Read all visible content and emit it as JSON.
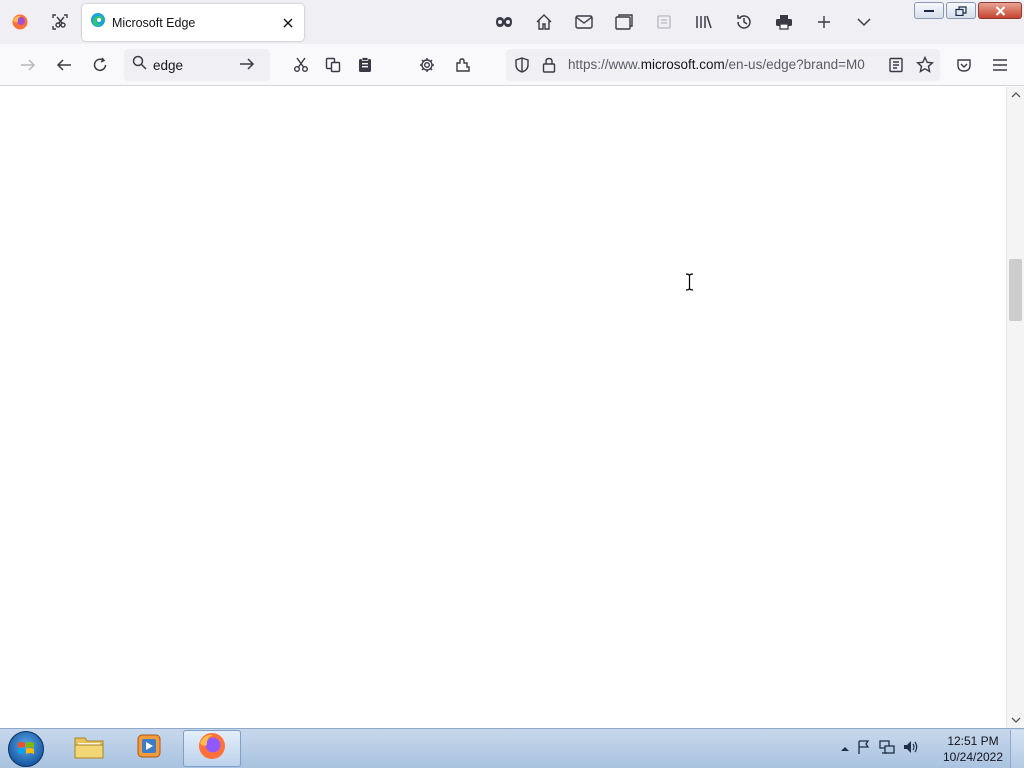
{
  "browser": {
    "tab": {
      "title": "Microsoft Edge"
    },
    "search": {
      "value": "edge"
    },
    "url": {
      "prefix": "https://www.",
      "domain": "microsoft.com",
      "rest": "/en-us/edge?brand=M0"
    }
  },
  "taskbar": {
    "clock": {
      "time": "12:51 PM",
      "date": "10/24/2022"
    }
  },
  "colors": {
    "accent": "#0060df",
    "taskbar": "#b9cfe8"
  }
}
